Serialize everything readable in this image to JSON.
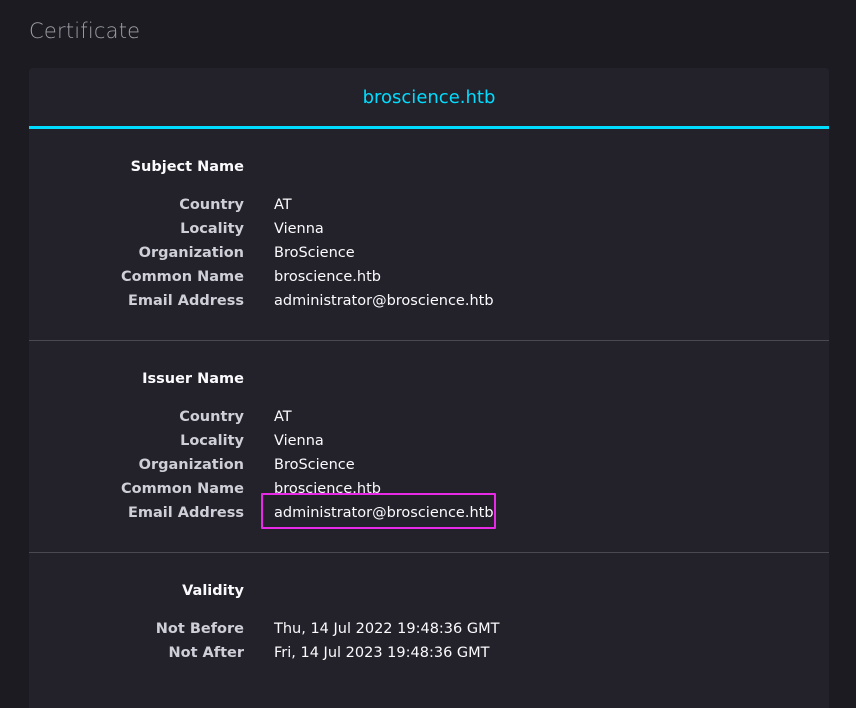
{
  "page": {
    "title": "Certificate"
  },
  "tab": {
    "label": "broscience.htb"
  },
  "subject": {
    "title": "Subject Name",
    "rows": [
      {
        "label": "Country",
        "value": "AT"
      },
      {
        "label": "Locality",
        "value": "Vienna"
      },
      {
        "label": "Organization",
        "value": "BroScience"
      },
      {
        "label": "Common Name",
        "value": "broscience.htb"
      },
      {
        "label": "Email Address",
        "value": "administrator@broscience.htb"
      }
    ]
  },
  "issuer": {
    "title": "Issuer Name",
    "rows": [
      {
        "label": "Country",
        "value": "AT"
      },
      {
        "label": "Locality",
        "value": "Vienna"
      },
      {
        "label": "Organization",
        "value": "BroScience"
      },
      {
        "label": "Common Name",
        "value": "broscience.htb"
      },
      {
        "label": "Email Address",
        "value": "administrator@broscience.htb"
      }
    ]
  },
  "validity": {
    "title": "Validity",
    "rows": [
      {
        "label": "Not Before",
        "value": "Thu, 14 Jul 2022 19:48:36 GMT"
      },
      {
        "label": "Not After",
        "value": "Fri, 14 Jul 2023 19:48:36 GMT"
      }
    ]
  },
  "colors": {
    "accent": "#00ddff",
    "highlight_box": "#e62ae6",
    "background": "#1c1b22",
    "card": "#23222b"
  }
}
